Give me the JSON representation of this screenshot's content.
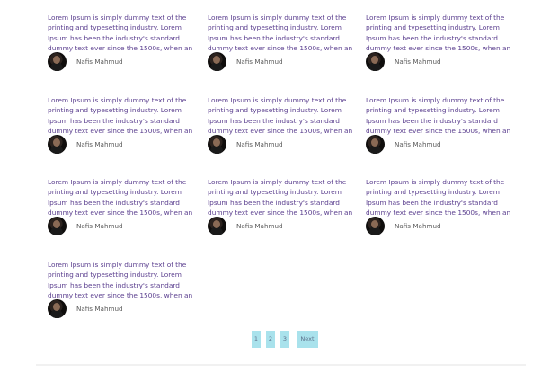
{
  "posts": [
    {
      "excerpt": "Lorem Ipsum is simply dummy text of the printing and typesetting industry. Lorem Ipsum has been the industry's standard dummy text ever since the 1500s, when an",
      "author": "Nafis Mahmud"
    },
    {
      "excerpt": "Lorem Ipsum is simply dummy text of the printing and typesetting industry. Lorem Ipsum has been the industry's standard dummy text ever since the 1500s, when an",
      "author": "Nafis Mahmud"
    },
    {
      "excerpt": "Lorem Ipsum is simply dummy text of the printing and typesetting industry. Lorem Ipsum has been the industry's standard dummy text ever since the 1500s, when an",
      "author": "Nafis Mahmud"
    },
    {
      "excerpt": "Lorem Ipsum is simply dummy text of the printing and typesetting industry. Lorem Ipsum has been the industry's standard dummy text ever since the 1500s, when an",
      "author": "Nafis Mahmud"
    },
    {
      "excerpt": "Lorem Ipsum is simply dummy text of the printing and typesetting industry. Lorem Ipsum has been the industry's standard dummy text ever since the 1500s, when an",
      "author": "Nafis Mahmud"
    },
    {
      "excerpt": "Lorem Ipsum is simply dummy text of the printing and typesetting industry. Lorem Ipsum has been the industry's standard dummy text ever since the 1500s, when an",
      "author": "Nafis Mahmud"
    },
    {
      "excerpt": "Lorem Ipsum is simply dummy text of the printing and typesetting industry. Lorem Ipsum has been the industry's standard dummy text ever since the 1500s, when an",
      "author": "Nafis Mahmud"
    },
    {
      "excerpt": "Lorem Ipsum is simply dummy text of the printing and typesetting industry. Lorem Ipsum has been the industry's standard dummy text ever since the 1500s, when an",
      "author": "Nafis Mahmud"
    },
    {
      "excerpt": "Lorem Ipsum is simply dummy text of the printing and typesetting industry. Lorem Ipsum has been the industry's standard dummy text ever since the 1500s, when an",
      "author": "Nafis Mahmud"
    },
    {
      "excerpt": "Lorem Ipsum is simply dummy text of the printing and typesetting industry. Lorem Ipsum has been the industry's standard dummy text ever since the 1500s, when an",
      "author": "Nafis Mahmud"
    }
  ],
  "pagination": {
    "pages": [
      "1",
      "2",
      "3"
    ],
    "next_label": "Next"
  },
  "colors": {
    "excerpt_text": "#5b3f8f",
    "author_text": "#5a5a5a",
    "pagination_bg": "#a9e2ec",
    "pagination_text": "#5c6f8a"
  }
}
